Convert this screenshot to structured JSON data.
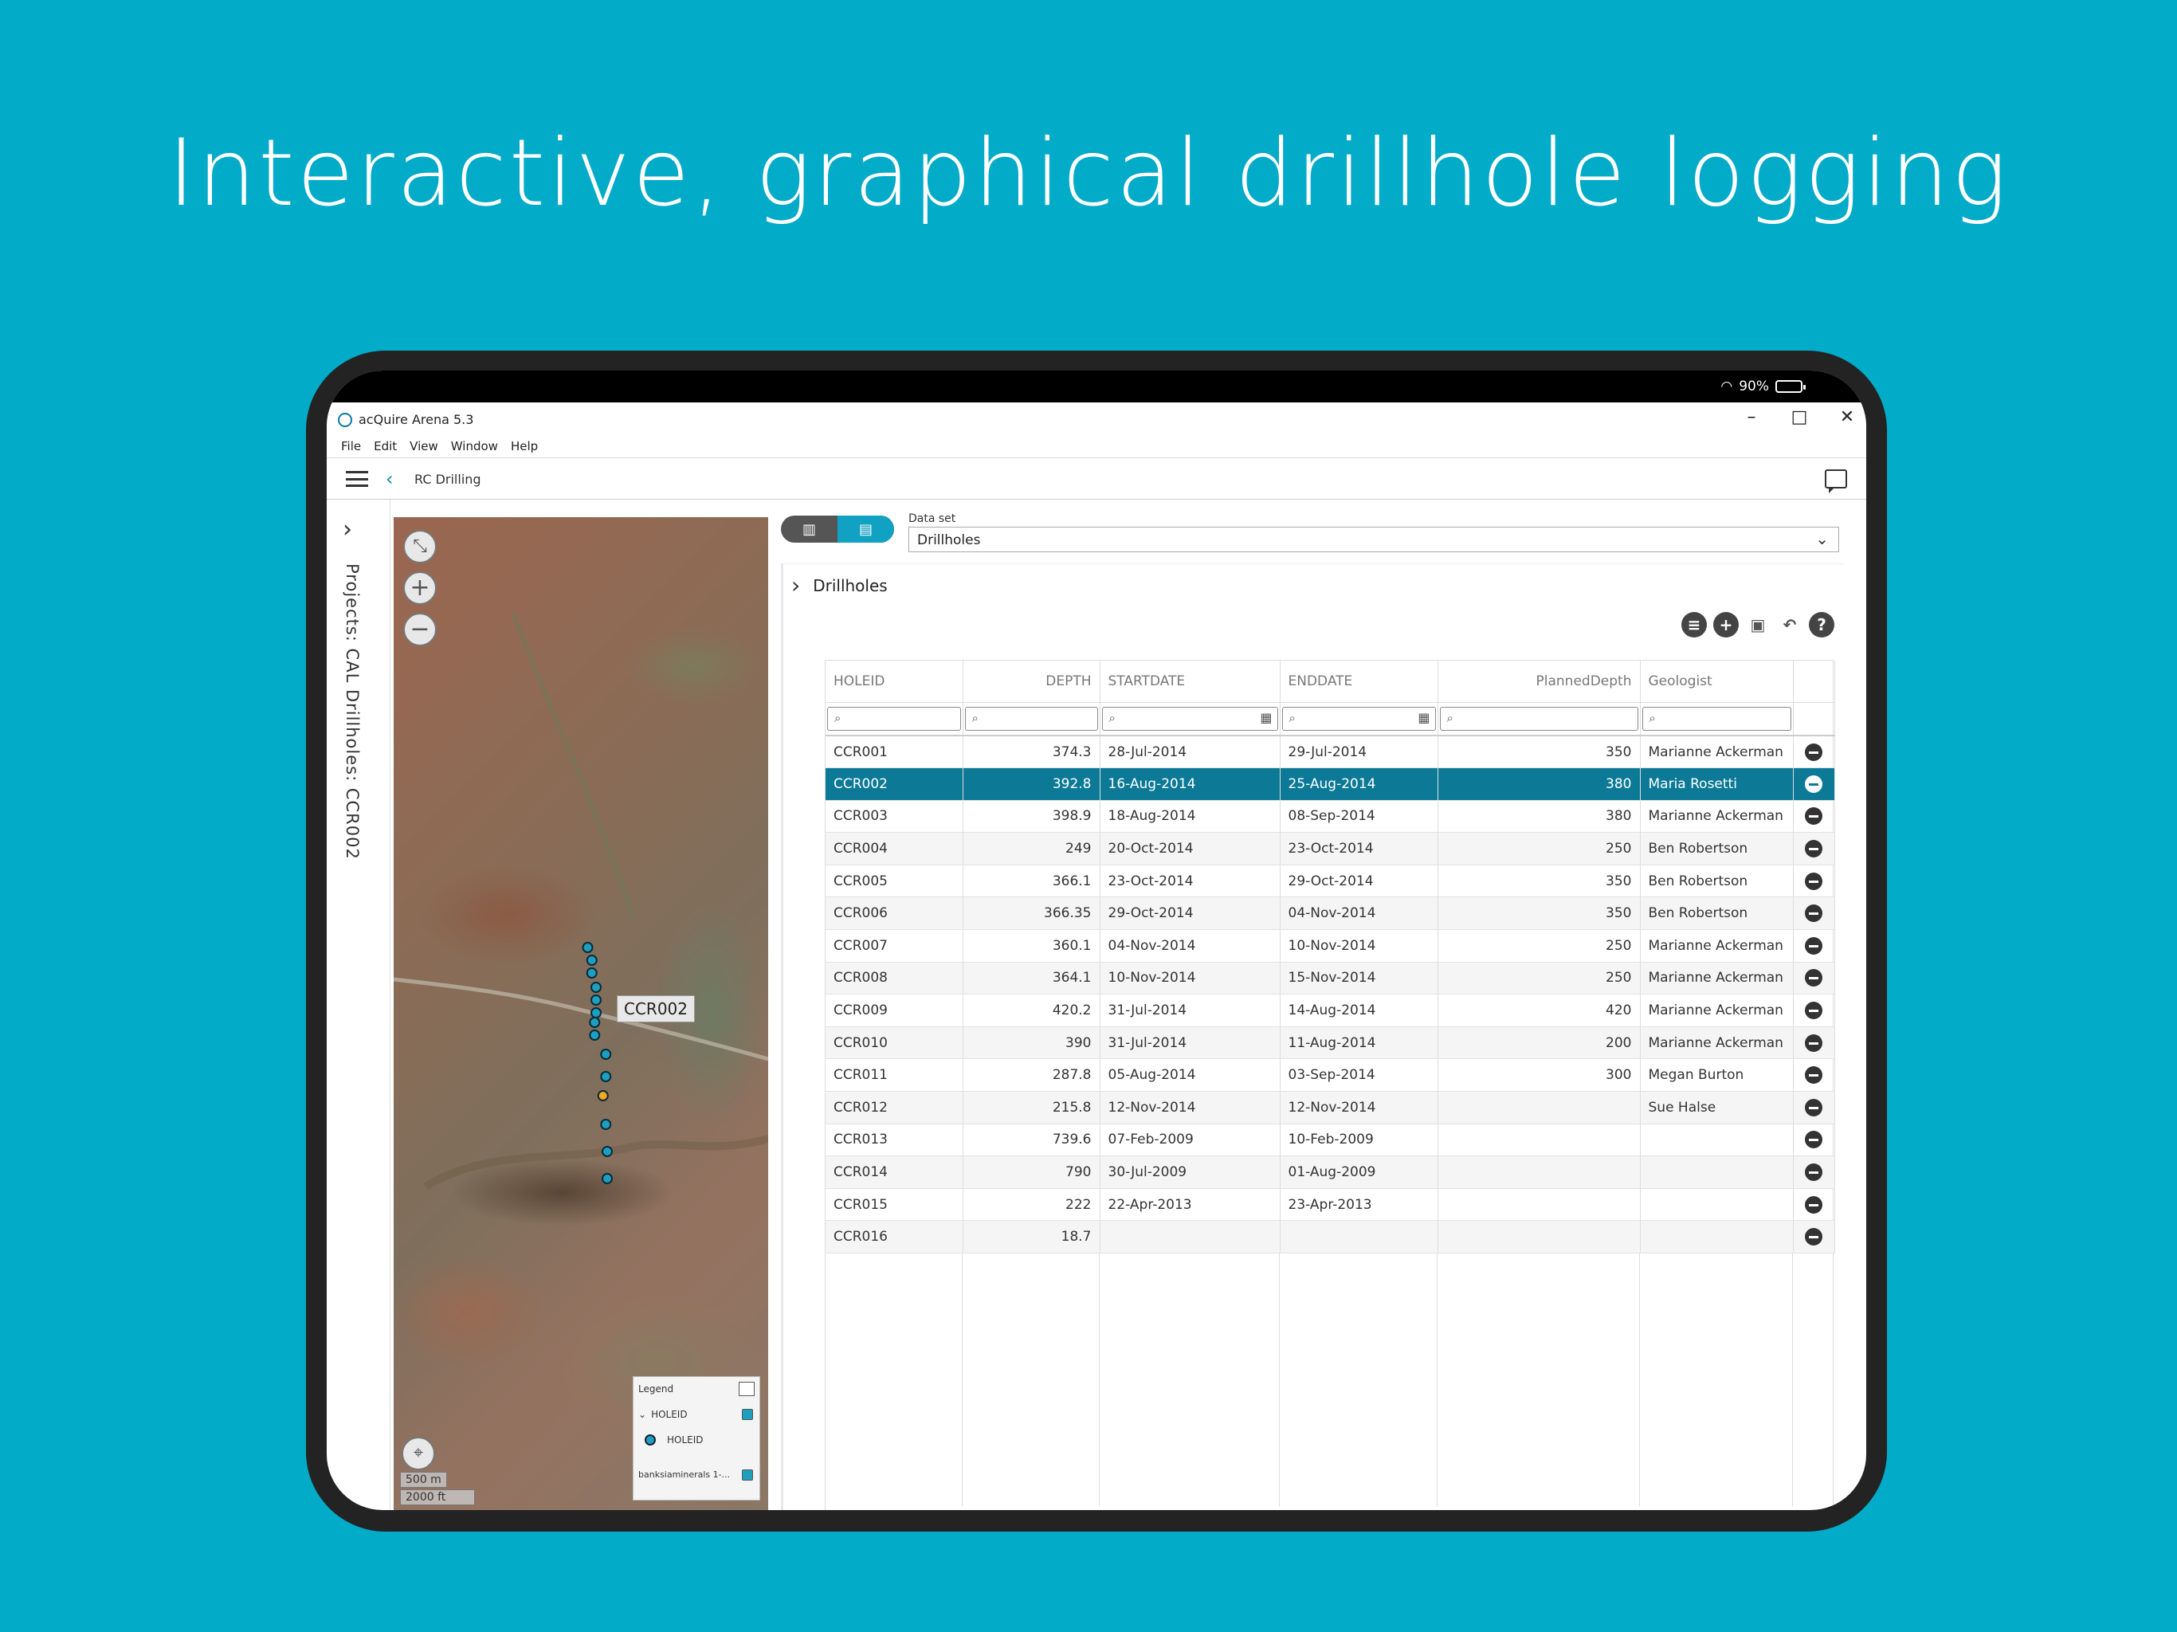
{
  "headline": "Interactive, graphical drillhole logging",
  "status": {
    "battery": "90%"
  },
  "window": {
    "title": "acQuire Arena 5.3",
    "minimize": "–",
    "maximize": "□",
    "close": "✕"
  },
  "menu": [
    "File",
    "Edit",
    "View",
    "Window",
    "Help"
  ],
  "nav": {
    "breadcrumb": "RC Drilling"
  },
  "sidebar": {
    "context": "Projects: CAL   Drillholes: CCR002"
  },
  "map": {
    "selected_label": "CCR002",
    "scale_m": "500 m",
    "scale_ft": "2000 ft",
    "legend": {
      "title": "Legend",
      "group": "HOLEID",
      "item": "HOLEID",
      "layer": "banksiaminerals 1-..."
    },
    "point_color": "#1e9fc0",
    "selected_color": "#f5a623"
  },
  "dataset": {
    "label": "Data set",
    "value": "Drillholes"
  },
  "panel": {
    "title": "Drillholes"
  },
  "table": {
    "columns": [
      "HOLEID",
      "DEPTH",
      "STARTDATE",
      "ENDDATE",
      "PlannedDepth",
      "Geologist"
    ],
    "rows": [
      [
        "CCR001",
        "374.3",
        "28-Jul-2014",
        "29-Jul-2014",
        "350",
        "Marianne Ackerman"
      ],
      [
        "CCR002",
        "392.8",
        "16-Aug-2014",
        "25-Aug-2014",
        "380",
        "Maria Rosetti"
      ],
      [
        "CCR003",
        "398.9",
        "18-Aug-2014",
        "08-Sep-2014",
        "380",
        "Marianne Ackerman"
      ],
      [
        "CCR004",
        "249",
        "20-Oct-2014",
        "23-Oct-2014",
        "250",
        "Ben Robertson"
      ],
      [
        "CCR005",
        "366.1",
        "23-Oct-2014",
        "29-Oct-2014",
        "350",
        "Ben Robertson"
      ],
      [
        "CCR006",
        "366.35",
        "29-Oct-2014",
        "04-Nov-2014",
        "350",
        "Ben Robertson"
      ],
      [
        "CCR007",
        "360.1",
        "04-Nov-2014",
        "10-Nov-2014",
        "250",
        "Marianne Ackerman"
      ],
      [
        "CCR008",
        "364.1",
        "10-Nov-2014",
        "15-Nov-2014",
        "250",
        "Marianne Ackerman"
      ],
      [
        "CCR009",
        "420.2",
        "31-Jul-2014",
        "14-Aug-2014",
        "420",
        "Marianne Ackerman"
      ],
      [
        "CCR010",
        "390",
        "31-Jul-2014",
        "11-Aug-2014",
        "200",
        "Marianne Ackerman"
      ],
      [
        "CCR011",
        "287.8",
        "05-Aug-2014",
        "03-Sep-2014",
        "300",
        "Megan Burton"
      ],
      [
        "CCR012",
        "215.8",
        "12-Nov-2014",
        "12-Nov-2014",
        "",
        "Sue Halse"
      ],
      [
        "CCR013",
        "739.6",
        "07-Feb-2009",
        "10-Feb-2009",
        "",
        ""
      ],
      [
        "CCR014",
        "790",
        "30-Jul-2009",
        "01-Aug-2009",
        "",
        ""
      ],
      [
        "CCR015",
        "222",
        "22-Apr-2013",
        "23-Apr-2013",
        "",
        ""
      ],
      [
        "CCR016",
        "18.7",
        "",
        "",
        "",
        ""
      ]
    ],
    "selected_row": 1,
    "accent": "#0c7a96"
  }
}
